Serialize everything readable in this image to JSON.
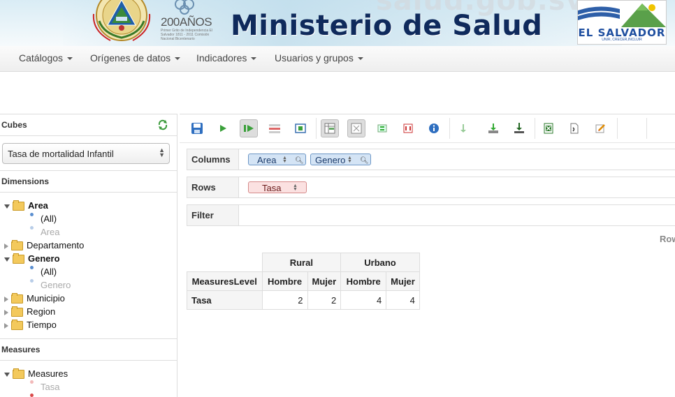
{
  "banner": {
    "watermark": "salud.gob.sv",
    "title": "Ministerio de Salud",
    "bicentenario_number": "200AÑOS",
    "bicentenario_sub": "Primer Grito de Independencia El Salvador 1811 - 2011 Comisión Nacional Bicentenario",
    "country": "EL SALVADOR",
    "country_tag": "UNIR, CRECER,INCLUIR",
    "colors": {
      "title": "#0f2a5c",
      "country": "#1f4fa0"
    }
  },
  "nav": {
    "items": [
      {
        "label": "Catálogos"
      },
      {
        "label": "Orígenes de datos"
      },
      {
        "label": "Indicadores"
      },
      {
        "label": "Usuarios y grupos"
      }
    ]
  },
  "left": {
    "cubes_header": "Cubes",
    "cube_selected": "Tasa de mortalidad Infantil",
    "dimensions_header": "Dimensions",
    "measures_header": "Measures",
    "tree": {
      "area": "Area",
      "area_all": "(All)",
      "area_level": "Area",
      "departamento": "Departamento",
      "genero": "Genero",
      "genero_all": "(All)",
      "genero_level": "Genero",
      "municipio": "Municipio",
      "region": "Region",
      "tiempo": "Tiempo",
      "measures_folder": "Measures",
      "tasa": "Tasa"
    }
  },
  "workspace": {
    "columns_label": "Columns",
    "rows_label": "Rows",
    "filter_label": "Filter",
    "columns_pills": [
      "Area",
      "Genero"
    ],
    "rows_pills": [
      "Tasa"
    ],
    "rows_right_label": "Row"
  },
  "pivot": {
    "col_groups": [
      "Rural",
      "Urbano"
    ],
    "row_header": "MeasuresLevel",
    "sub_headers": [
      "Hombre",
      "Mujer",
      "Hombre",
      "Mujer"
    ],
    "rows": [
      {
        "label": "Tasa",
        "values": [
          "2",
          "2",
          "4",
          "4"
        ]
      }
    ]
  }
}
